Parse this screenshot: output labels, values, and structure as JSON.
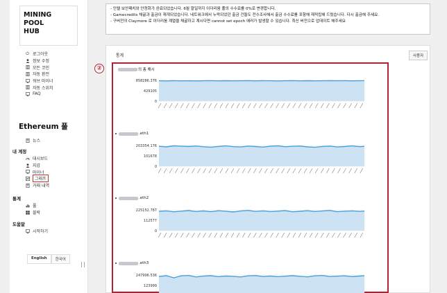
{
  "logo": {
    "lines": [
      "MINING",
      "POOL",
      "HUB"
    ]
  },
  "sidebar": {
    "top_items": [
      {
        "icon": "power-icon",
        "label": "로그아웃"
      },
      {
        "icon": "user-icon",
        "label": "정보 수정"
      },
      {
        "icon": "document-icon",
        "label": "모든 코인"
      },
      {
        "icon": "document-icon",
        "label": "자동 환전"
      },
      {
        "icon": "monitor-icon",
        "label": "워브 마이너"
      },
      {
        "icon": "document-icon",
        "label": "자동 스위치"
      },
      {
        "icon": "monitor-icon",
        "label": "FAQ"
      }
    ],
    "pool_title": "Ethereum 풀",
    "news": {
      "icon": "document-icon",
      "label": "뉴스"
    },
    "my_account": {
      "title": "내 계정",
      "items": [
        {
          "icon": "dashboard-icon",
          "label": "대시보드"
        },
        {
          "icon": "user-icon",
          "label": "지갑"
        },
        {
          "icon": "monitor-icon",
          "label": "마이너"
        },
        {
          "icon": "graph-icon",
          "label": "그래프",
          "highlight": true
        },
        {
          "icon": "document-icon",
          "label": "거래 내역"
        }
      ]
    },
    "stats": {
      "title": "통계",
      "items": [
        {
          "icon": "bars-icon",
          "label": "풀"
        },
        {
          "icon": "grid-icon",
          "label": "블락"
        }
      ]
    },
    "help": {
      "title": "도움말",
      "items": [
        {
          "icon": "monitor-icon",
          "label": "시작하기"
        }
      ]
    },
    "lang": {
      "english": "English",
      "korean": "한국어"
    }
  },
  "notice": {
    "lines": [
      "- 인텔 보안패치와 안정화가 완료되었습니다. 6월 말일까지 이더리움 풀의 수수료를 0%로 변경합니다.",
      "- Gamecredits 채굴과 출금이 재개되었습니다. 네트워크에서 누락되었던 출금 건들도 전수조사해서 출금 수수료를 포함해 재적립해 드렸습니다. 다시 출금해 주세요.",
      "- 구버전의 Claymore 로 이더리움 계열을 채굴하고 계시다면 cannot set epoch 에러가 발생할 수 있습니다. 최신 버전으로 업데이트 해주세요"
    ]
  },
  "panel": {
    "title": "통계",
    "user_button": "사용자"
  },
  "annotation": {
    "number": "②"
  },
  "charts": [
    {
      "caption": "의 총 해시",
      "y_top": "858286.376",
      "y_mid": "429105",
      "y_zero": "0"
    },
    {
      "caption": ".eth1",
      "y_top": "203354.176",
      "y_mid": "101678",
      "y_zero": "0"
    },
    {
      "caption": ".eth2",
      "y_top": "225152.787",
      "y_mid": "112577",
      "y_zero": "0"
    },
    {
      "caption": ".eth3",
      "y_top": "247996.536",
      "y_mid": "123999",
      "y_zero": "0"
    }
  ],
  "chart_data": [
    {
      "type": "area",
      "title": "의 총 해시",
      "ylim": [
        0,
        858286.376
      ],
      "series": [
        {
          "values": [
            840000,
            835000,
            845000,
            838000,
            842000,
            836000,
            840000,
            845000,
            839000,
            843000,
            837000,
            841000,
            846000,
            838000,
            844000,
            840000,
            836000,
            842000,
            847000,
            839000,
            843000,
            838000,
            841000,
            845000,
            840000,
            844000,
            838000,
            842000,
            846000,
            841000,
            843000
          ]
        }
      ]
    },
    {
      "type": "area",
      "title": ".eth1",
      "ylim": [
        0,
        203354.176
      ],
      "series": [
        {
          "values": [
            195000,
            190000,
            200000,
            196000,
            193000,
            198000,
            191000,
            187000,
            194000,
            199000,
            192000,
            189000,
            197000,
            193000,
            188000,
            196000,
            200000,
            191000,
            195000,
            198000,
            190000,
            186000,
            194000,
            197000,
            189000,
            193000,
            199000,
            192000,
            196000,
            201000,
            180000
          ]
        }
      ]
    },
    {
      "type": "area",
      "title": ".eth2",
      "ylim": [
        0,
        225152.787
      ],
      "series": [
        {
          "values": [
            210000,
            215000,
            205000,
            212000,
            218000,
            208000,
            214000,
            206000,
            216000,
            211000,
            203000,
            213000,
            219000,
            209000,
            215000,
            207000,
            212000,
            217000,
            205000,
            210000,
            216000,
            208000,
            213000,
            219000,
            206000,
            211000,
            215000,
            209000,
            214000,
            218000,
            212000
          ]
        }
      ]
    },
    {
      "type": "area",
      "title": ".eth3",
      "ylim": [
        0,
        247996.536
      ],
      "series": [
        {
          "values": [
            230000,
            240000,
            215000,
            238000,
            242000,
            225000,
            235000,
            240000,
            228000,
            236000,
            232000,
            225000,
            238000,
            241000,
            230000,
            236000,
            228000,
            234000,
            240000,
            232000,
            226000,
            238000,
            242000,
            230000,
            234000,
            238000,
            229000,
            236000,
            241000,
            233000,
            237000
          ]
        }
      ]
    }
  ],
  "colors": {
    "line": "#4a9fd8",
    "fill": "#cde3f4",
    "grid": "#e4e4e4",
    "accent": "#b22234"
  }
}
